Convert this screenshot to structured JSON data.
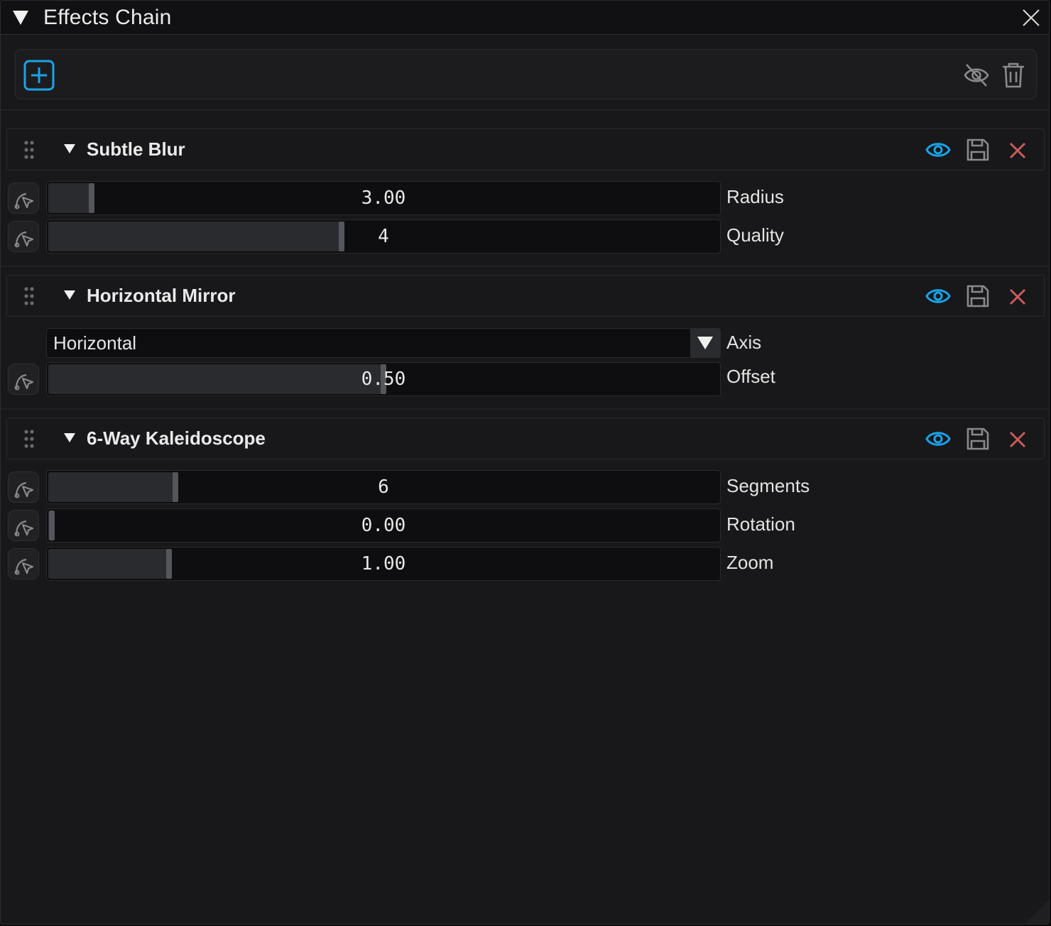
{
  "window": {
    "title": "Effects Chain"
  },
  "colors": {
    "accent": "#1aa3e8",
    "remove": "#c95b5b",
    "icon": "#8a8a8e"
  },
  "effects": [
    {
      "name": "Subtle Blur",
      "params": [
        {
          "type": "slider",
          "label": "Radius",
          "value": "3.00",
          "fraction": 0.065
        },
        {
          "type": "slider",
          "label": "Quality",
          "value": "4",
          "fraction": 0.437
        }
      ]
    },
    {
      "name": "Horizontal Mirror",
      "params": [
        {
          "type": "dropdown",
          "label": "Axis",
          "value": "Horizontal"
        },
        {
          "type": "slider",
          "label": "Offset",
          "value": "0.50",
          "fraction": 0.5
        }
      ]
    },
    {
      "name": "6-Way Kaleidoscope",
      "params": [
        {
          "type": "slider",
          "label": "Segments",
          "value": "6",
          "fraction": 0.19
        },
        {
          "type": "slider",
          "label": "Rotation",
          "value": "0.00",
          "fraction": 0.005
        },
        {
          "type": "slider",
          "label": "Zoom",
          "value": "1.00",
          "fraction": 0.18
        }
      ]
    }
  ]
}
